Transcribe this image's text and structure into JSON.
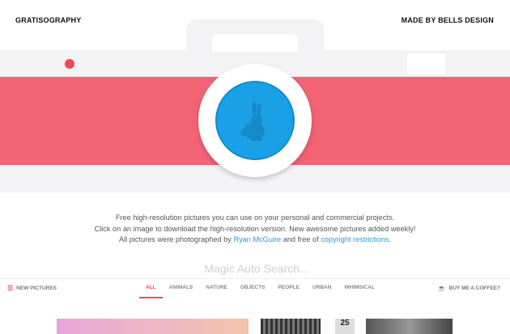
{
  "header": {
    "logo": "GRATISOGRAPHY",
    "made_by": "MADE BY BELLS DESIGN"
  },
  "intro": {
    "line1": "Free high-resolution pictures you can use on your personal and commercial projects.",
    "line2": "Click on an image to download the high-resolution version. New awesome pictures added weekly!",
    "line3_prefix": "All pictures were photographed by ",
    "photographer": "Ryan McGuire",
    "line3_middle": " and free of ",
    "restrictions_link": "copyright restrictions",
    "line3_suffix": "."
  },
  "search": {
    "placeholder": "Magic Auto Search..."
  },
  "nav": {
    "new_pictures": "NEW PICTURES",
    "buy_coffee": "BUY ME A COFFEE?",
    "filters": [
      "ALL",
      "ANIMALS",
      "NATURE",
      "OBJECTS",
      "PEOPLE",
      "URBAN",
      "WHIMSICAL"
    ],
    "active_filter": "ALL"
  },
  "thumbnails": {
    "sign_text": "25"
  },
  "colors": {
    "stripe": "#f26475",
    "lens": "#1aa0e6",
    "accent": "#ef4a5a",
    "link": "#2a9bd8"
  }
}
